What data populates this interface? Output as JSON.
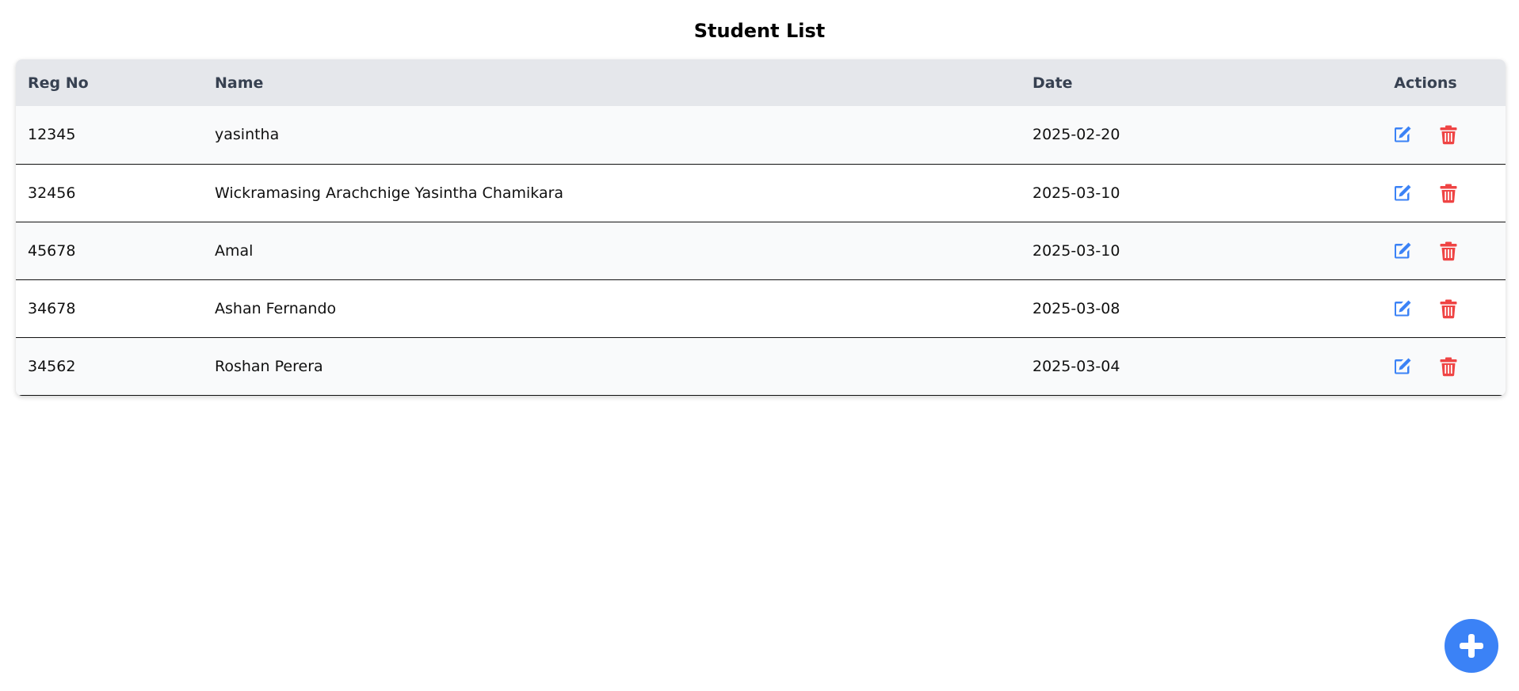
{
  "page": {
    "title": "Student List"
  },
  "table": {
    "headers": {
      "reg_no": "Reg No",
      "name": "Name",
      "date": "Date",
      "actions": "Actions"
    },
    "rows": [
      {
        "reg_no": "12345",
        "name": "yasintha",
        "date": "2025-02-20"
      },
      {
        "reg_no": "32456",
        "name": "Wickramasing Arachchige Yasintha Chamikara",
        "date": "2025-03-10"
      },
      {
        "reg_no": "45678",
        "name": "Amal",
        "date": "2025-03-10"
      },
      {
        "reg_no": "34678",
        "name": "Ashan Fernando",
        "date": "2025-03-08"
      },
      {
        "reg_no": "34562",
        "name": "Roshan Perera",
        "date": "2025-03-04"
      }
    ]
  },
  "icons": {
    "edit": "edit-icon",
    "delete": "trash-icon",
    "add": "plus-icon"
  },
  "colors": {
    "edit": "#3b82f6",
    "delete": "#ef4444",
    "fab": "#3b82f6",
    "header_bg": "#e5e7eb"
  }
}
